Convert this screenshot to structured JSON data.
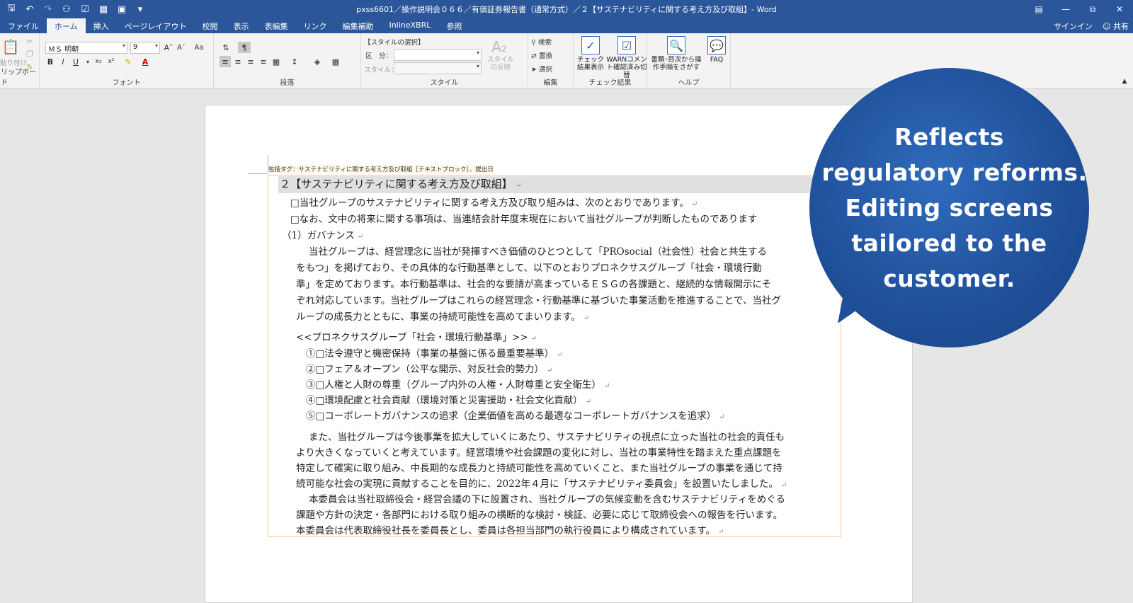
{
  "window": {
    "title": "pxss6601／操作説明会０６６／有価証券報告書（通常方式）／２【サステナビリティに関する考え方及び取組】- Word",
    "controls": [
      "ribbon-display-icon",
      "minimize-icon",
      "restore-icon",
      "close-icon"
    ]
  },
  "tabs": [
    "ファイル",
    "ホーム",
    "挿入",
    "ページレイアウト",
    "校閲",
    "表示",
    "表編集",
    "リンク",
    "編集補助",
    "InlineXBRL",
    "参照"
  ],
  "active_tab": "ホーム",
  "account": {
    "signin": "サインイン",
    "share": "共有"
  },
  "ribbon": {
    "clipboard": {
      "paste": "貼り付け",
      "label": "リップボード"
    },
    "font": {
      "name": "ＭＳ 明朝",
      "size": "9",
      "label": "フォント",
      "aa": "Aa"
    },
    "paragraph": {
      "label": "段落"
    },
    "style": {
      "header": "【スタイルの選択】",
      "kubun": "区　分：",
      "style_label": "スタイル：",
      "apply": "スタイルの反映",
      "label": "スタイル"
    },
    "edit": {
      "find": "検索",
      "replace": "置換",
      "select": "選択",
      "label": "編集"
    },
    "check": {
      "btn1": "チェック結果表示",
      "btn2": "WARNコメント確認済み切替",
      "label": "チェック結果"
    },
    "help": {
      "btn1": "書類･目次から操作手順をさがす",
      "btn2": "FAQ",
      "label": "ヘルプ"
    }
  },
  "document": {
    "tag": "包括タグ：サステナビリティに関する考え方及び取組［テキストブロック］、提出日",
    "heading": "２【サステナビリティに関する考え方及び取組】",
    "lines": [
      "□当社グループのサステナビリティに関する考え方及び取り組みは、次のとおりであります。",
      "□なお、文中の将来に関する事項は、当連結会計年度末現在において当社グループが判断したものであります",
      "（1）ガバナンス",
      "当社グループは、経営理念に当社が発揮すべき価値のひとつとして「PROsocial（社会性）社会と共生する",
      "をもつ」を掲げており、その具体的な行動基準として、以下のとおりプロネクサスグループ「社会・環境行動",
      "準」を定めております。本行動基準は、社会的な要請が高まっているＥＳＧの各課題と、継続的な情報開示にそ",
      "ぞれ対応しています。当社グループはこれらの経営理念・行動基準に基づいた事業活動を推進することで、当社グ",
      "ループの成長力とともに、事業の持続可能性を高めてまいります。",
      "<<プロネクサスグループ「社会・環境行動基準」>>",
      "①□法令遵守と機密保持（事業の基盤に係る最重要基準）",
      "②□フェア＆オープン（公平な開示、対反社会的勢力）",
      "③□人権と人財の尊重（グループ内外の人権・人財尊重と安全衛生）",
      "④□環境配慮と社会貢献（環境対策と災害援助・社会文化貢献）",
      "⑤□コーポレートガバナンスの追求（企業価値を高める最適なコーポレートガバナンスを追求）",
      "また、当社グループは今後事業を拡大していくにあたり、サステナビリティの視点に立った当社の社会的責任も",
      "より大きくなっていくと考えています。経営環境や社会課題の変化に対し、当社の事業特性を踏まえた重点課題を",
      "特定して確実に取り組み、中長期的な成長力と持続可能性を高めていくこと、また当社グループの事業を通じて持",
      "続可能な社会の実現に貢献することを目的に、2022年４月に「サステナビリティ委員会」を設置いたしました。",
      "本委員会は当社取締役会・経営会議の下に設置され、当社グループの気候変動を含むサステナビリティをめぐる",
      "課題や方針の決定・各部門における取り組みの横断的な検討・検証、必要に応じて取締役会への報告を行います。",
      "本委員会は代表取締役社長を委員長とし、委員は各担当部門の執行役員により構成されています。"
    ]
  },
  "callout": {
    "lines": [
      "Reflects",
      "regulatory  reforms.",
      "Editing screens",
      "tailored to the",
      "customer."
    ]
  },
  "colors": {
    "accent": "#2b579a",
    "bubble": "#1f4f98",
    "tag_border": "#f3c896"
  }
}
